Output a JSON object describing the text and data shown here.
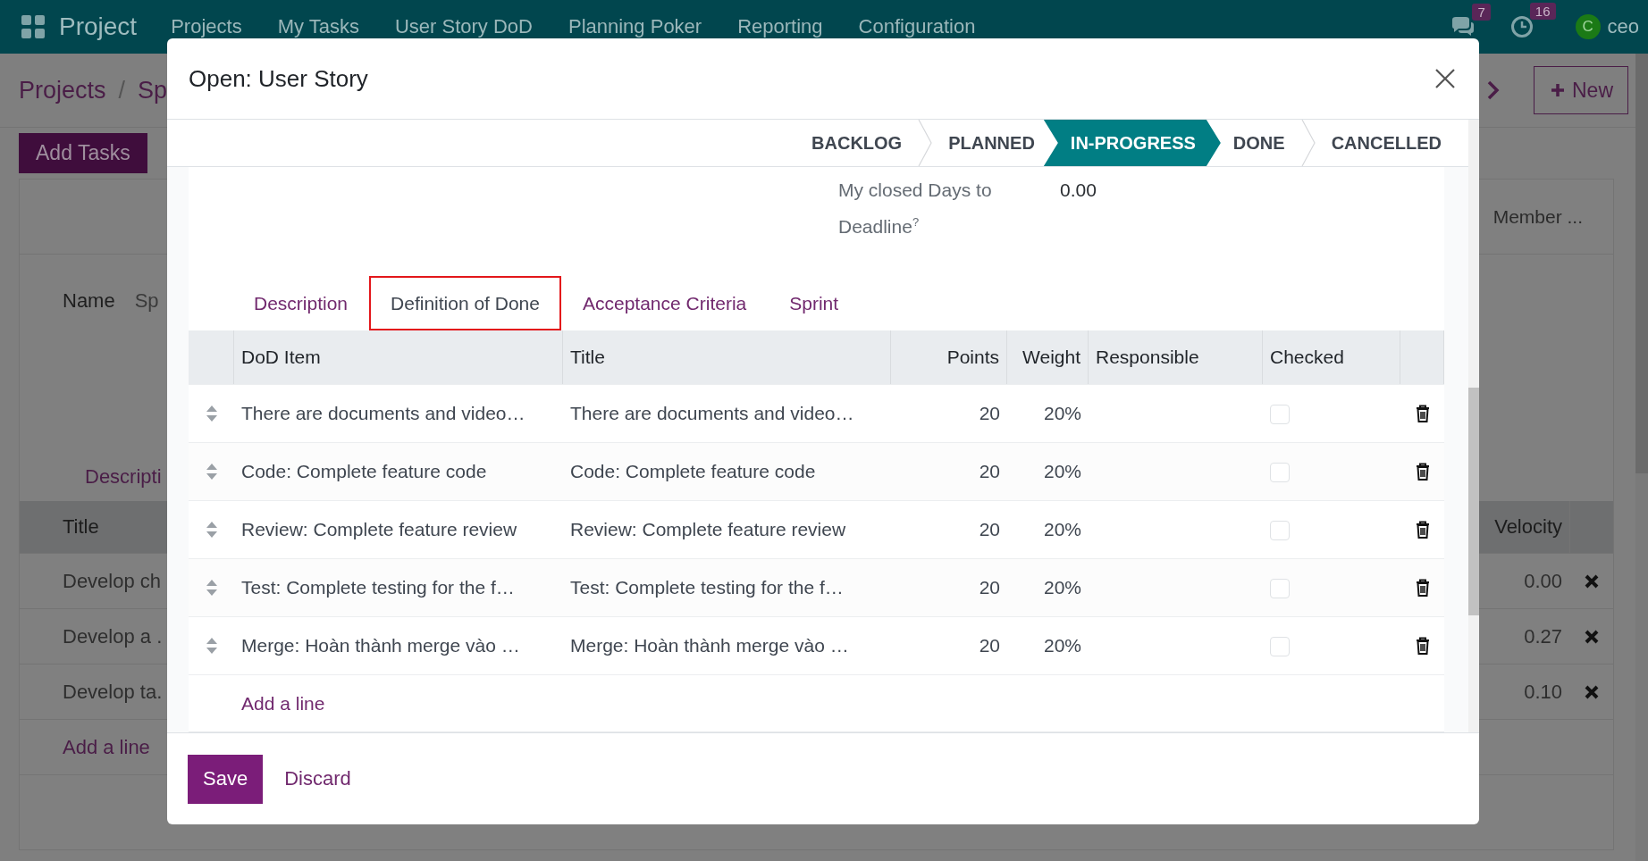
{
  "navbar": {
    "app_name": "Project",
    "menu": [
      "Projects",
      "My Tasks",
      "User Story DoD",
      "Planning Poker",
      "Reporting",
      "Configuration"
    ],
    "messages_badge": "7",
    "activities_badge": "16",
    "user_initial": "C",
    "user_name": "ceo"
  },
  "background": {
    "breadcrumb": [
      "Projects",
      "/",
      "Sp"
    ],
    "new_button": "New",
    "add_tasks_button": "Add Tasks",
    "header_text": "Member ...",
    "name_label": "Name",
    "name_value": "Sp",
    "tab": "Descripti",
    "table": {
      "columns": [
        "Title",
        "Velocity"
      ],
      "rows": [
        {
          "title": "Develop ch",
          "velocity": "0.00"
        },
        {
          "title": "Develop a .",
          "velocity": "0.27"
        },
        {
          "title": "Develop ta.",
          "velocity": "0.10"
        }
      ]
    },
    "add_line": "Add a line"
  },
  "dialog": {
    "title": "Open: User Story",
    "stages": [
      {
        "label": "BACKLOG",
        "selected": false
      },
      {
        "label": "PLANNED",
        "selected": false
      },
      {
        "label": "IN-PROGRESS",
        "selected": true
      },
      {
        "label": "DONE",
        "selected": false
      },
      {
        "label": "CANCELLED",
        "selected": false
      }
    ],
    "fields": [
      {
        "label": "My closed Days to Deadline$^{?}$",
        "value": "0.00"
      }
    ],
    "tabs": [
      {
        "label": "Description",
        "selected": false
      },
      {
        "label": "Definition of Done",
        "selected": true
      },
      {
        "label": "Acceptance Criteria",
        "selected": false
      },
      {
        "label": "Sprint",
        "selected": false
      }
    ],
    "dod_table": {
      "columns": [
        "DoD Item",
        "Title",
        "Points",
        "Weight",
        "Responsible",
        "Checked"
      ],
      "rows": [
        {
          "dod_item": "There are documents and video…",
          "title": "There are documents and video…",
          "points": "20",
          "weight": "20%",
          "checked": false
        },
        {
          "dod_item": "Code: Complete feature code",
          "title": "Code: Complete feature code",
          "points": "20",
          "weight": "20%",
          "checked": false
        },
        {
          "dod_item": "Review: Complete feature review",
          "title": "Review: Complete feature review",
          "points": "20",
          "weight": "20%",
          "checked": false
        },
        {
          "dod_item": "Test: Complete testing for the f…",
          "title": "Test: Complete testing for the f…",
          "points": "20",
          "weight": "20%",
          "checked": false
        },
        {
          "dod_item": "Merge: Hoàn thành merge vào …",
          "title": "Merge: Hoàn thành merge vào …",
          "points": "20",
          "weight": "20%",
          "checked": false
        }
      ],
      "add_line": "Add a line"
    },
    "buttons": {
      "save": "Save",
      "discard": "Discard"
    }
  }
}
